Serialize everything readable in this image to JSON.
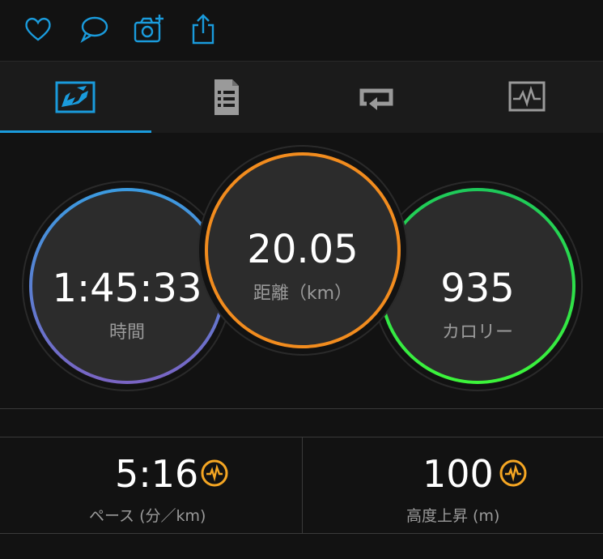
{
  "toolbar": {
    "icons": [
      "heart-icon",
      "comment-icon",
      "add-photo-icon",
      "share-icon"
    ],
    "accent": "#1a9bdc"
  },
  "tabs": [
    {
      "icon": "map-overview-icon",
      "active": true
    },
    {
      "icon": "stats-document-icon",
      "active": false
    },
    {
      "icon": "laps-icon",
      "active": false
    },
    {
      "icon": "chart-icon",
      "active": false
    }
  ],
  "hero": {
    "time": {
      "value": "1:45:33",
      "label": "時間",
      "colors": [
        "#3b9be0",
        "#7a64c4"
      ]
    },
    "distance": {
      "value": "20.05",
      "label": "距離（km）",
      "color": "#f28c1e"
    },
    "calories": {
      "value": "935",
      "label": "カロリー",
      "colors": [
        "#1ec95a",
        "#3cf53a"
      ]
    }
  },
  "stats": [
    {
      "value": "5:16",
      "label": "ペース (分／km)",
      "icon": "heart-rate-badge-icon",
      "icon_color": "#f5a623"
    },
    {
      "value": "100",
      "label": "高度上昇 (m)",
      "icon": "heart-rate-badge-icon",
      "icon_color": "#f5a623"
    }
  ]
}
